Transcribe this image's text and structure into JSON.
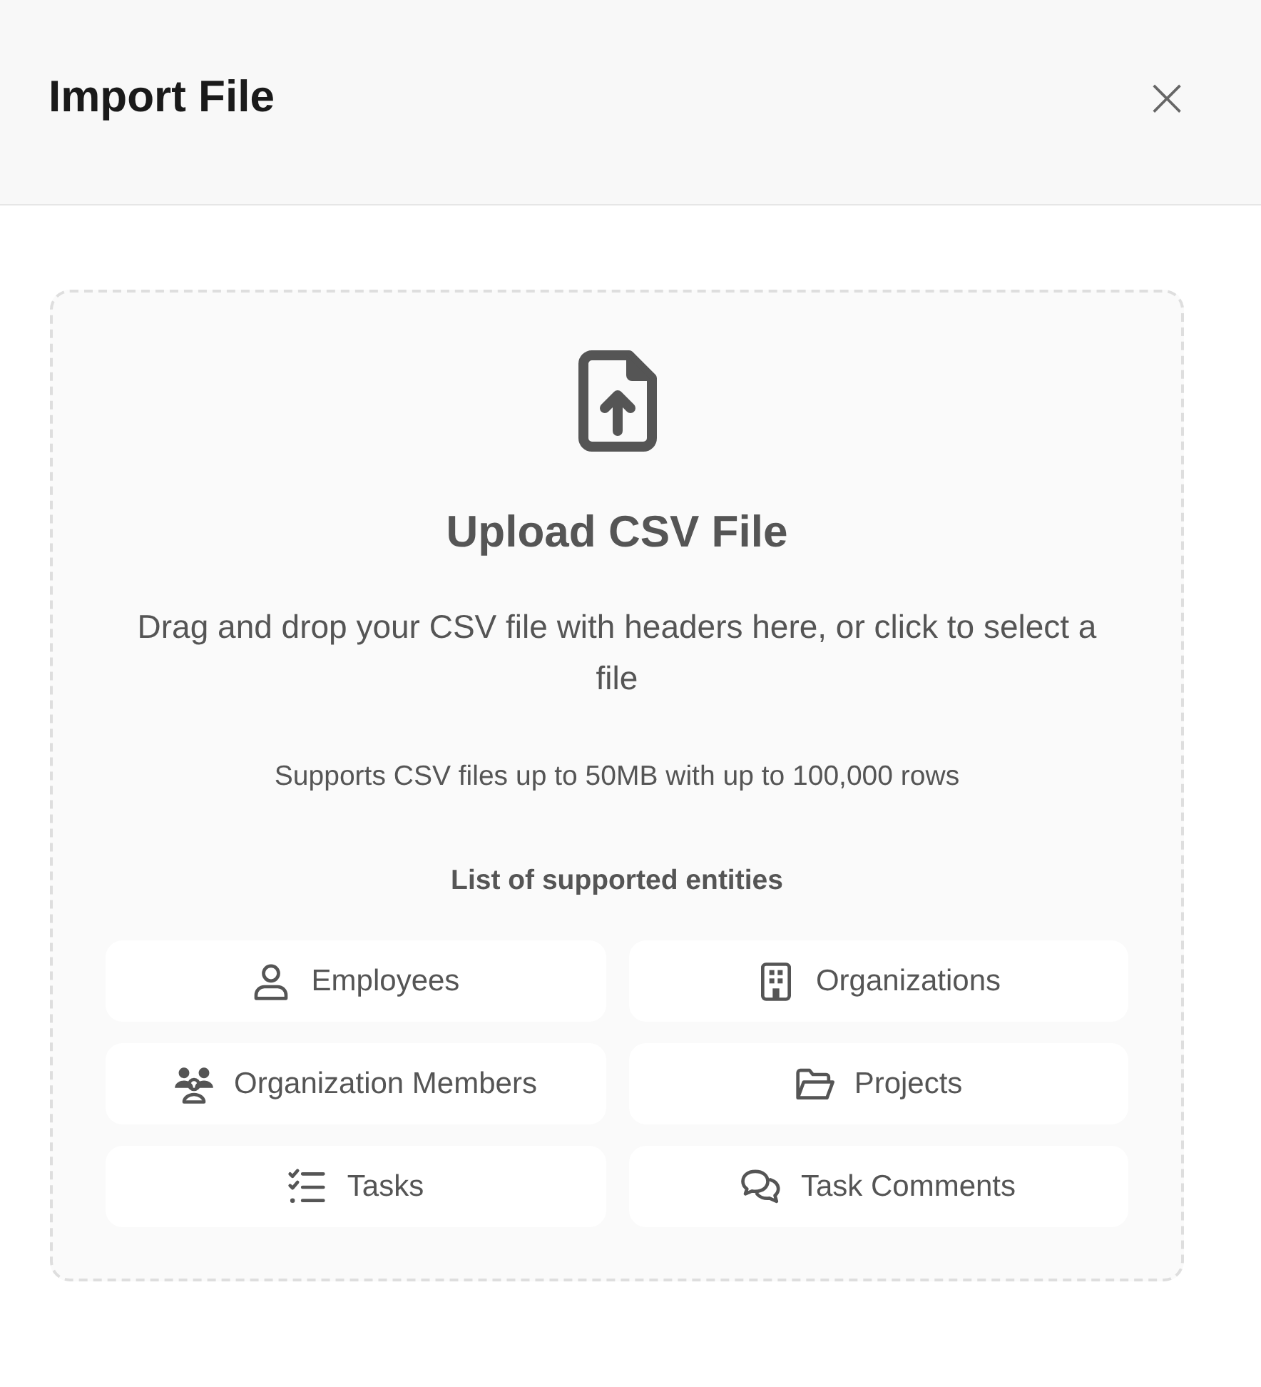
{
  "dialog": {
    "title": "Import File",
    "close_label": "×"
  },
  "dropzone": {
    "heading": "Upload CSV File",
    "description": "Drag and drop your CSV file with headers here, or click to select a file",
    "limits": "Supports CSV files up to 50MB with up to 100,000 rows",
    "entities_heading": "List of supported entities",
    "entities": [
      {
        "label": "Employees",
        "kind": "person"
      },
      {
        "label": "Organizations",
        "kind": "building"
      },
      {
        "label": "Organization Members",
        "kind": "group"
      },
      {
        "label": "Projects",
        "kind": "folder"
      },
      {
        "label": "Tasks",
        "kind": "checklist"
      },
      {
        "label": "Task Comments",
        "kind": "chat"
      }
    ]
  }
}
